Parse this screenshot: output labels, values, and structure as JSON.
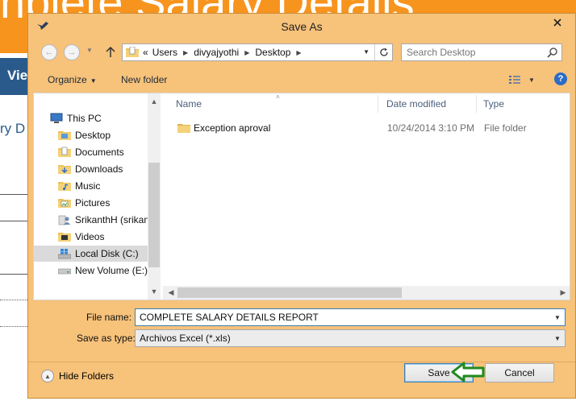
{
  "background_app": {
    "banner_text": "nplete Salary Details",
    "nav_tab": "Vie",
    "heading": "ry D"
  },
  "dialog": {
    "title": "Save As",
    "close_icon": "close-icon",
    "address": {
      "overflow": "«",
      "crumbs": [
        "Users",
        "divyajyothi",
        "Desktop"
      ]
    },
    "search_placeholder": "Search Desktop",
    "toolbar": {
      "organize_label": "Organize",
      "new_folder_label": "New folder"
    },
    "nav_items": [
      {
        "label": "This PC",
        "icon": "pc-icon",
        "selected": false
      },
      {
        "label": "Desktop",
        "icon": "folder-icon",
        "selected": false
      },
      {
        "label": "Documents",
        "icon": "folder-icon",
        "selected": false
      },
      {
        "label": "Downloads",
        "icon": "folder-icon",
        "selected": false
      },
      {
        "label": "Music",
        "icon": "folder-icon",
        "selected": false
      },
      {
        "label": "Pictures",
        "icon": "folder-icon",
        "selected": false
      },
      {
        "label": "SrikanthH (srikan",
        "icon": "user-folder-icon",
        "selected": false
      },
      {
        "label": "Videos",
        "icon": "folder-icon",
        "selected": false
      },
      {
        "label": "Local Disk (C:)",
        "icon": "windows-drive-icon",
        "selected": true
      },
      {
        "label": "New Volume (E:)",
        "icon": "drive-icon",
        "selected": false
      }
    ],
    "columns": {
      "name": "Name",
      "date_modified": "Date modified",
      "type": "Type"
    },
    "files": [
      {
        "name": "Exception aproval",
        "date_modified": "10/24/2014 3:10 PM",
        "type": "File folder"
      }
    ],
    "file_name_label": "File name:",
    "file_name_value": "COMPLETE SALARY DETAILS REPORT",
    "save_as_type_label": "Save as type:",
    "save_as_type_value": "Archivos Excel (*.xls)",
    "hide_folders_label": "Hide Folders",
    "save_label": "Save",
    "cancel_label": "Cancel",
    "colors": {
      "dialog_frame": "#f7c27a",
      "banner": "#f7941d",
      "accent": "#3c7fb1",
      "annotation_arrow": "#1f8a1f"
    }
  }
}
